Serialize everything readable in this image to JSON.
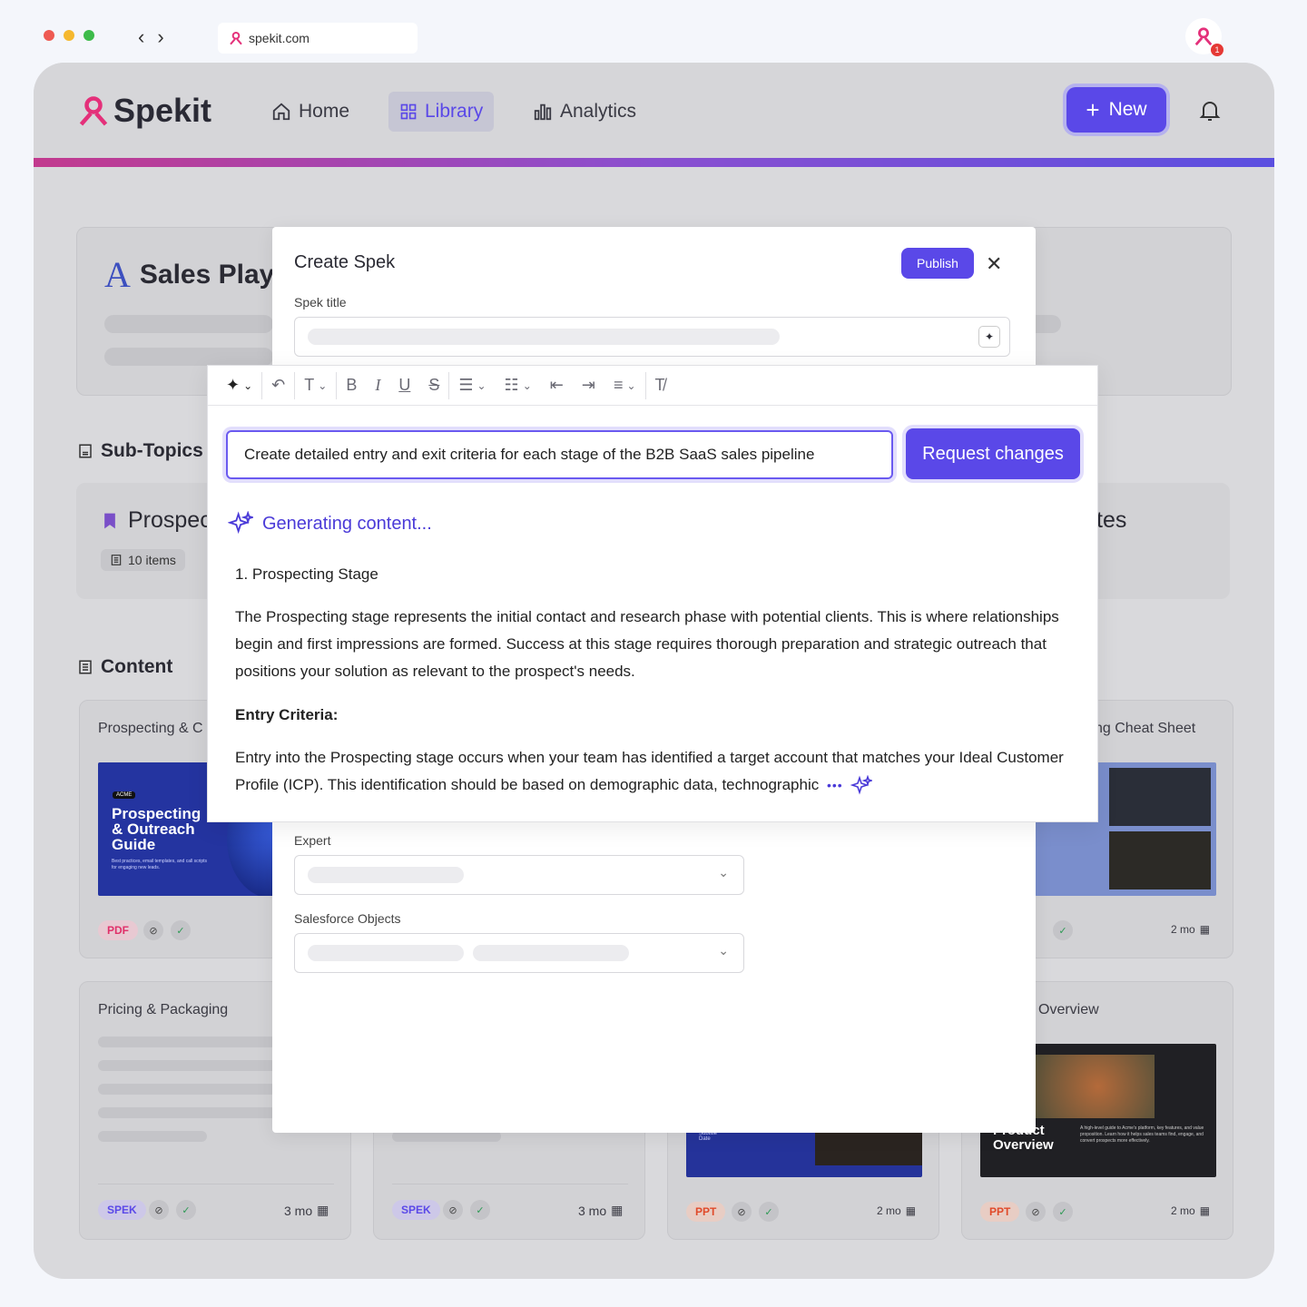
{
  "browser": {
    "url": "spekit.com",
    "ext_badge": "1",
    "dot_colors": [
      "#ee5a52",
      "#f5b82e",
      "#3dbb4a"
    ]
  },
  "nav": {
    "logo": "Spekit",
    "home": "Home",
    "library": "Library",
    "analytics": "Analytics",
    "new_label": "New"
  },
  "page": {
    "topic_title": "Sales Playl",
    "subtopics_heading": "Sub-Topics",
    "subtopic_name": "Prospec",
    "subtopic_count": "10 items",
    "subtopic_right": "tes",
    "content_heading": "Content",
    "cards": [
      {
        "title": "Prospecting & C",
        "type": "PDF",
        "thumb_title": "Prospecting & Outreach Guide",
        "thumb_sub": "Best practices, email templates, and call scripts for engaging new leads.",
        "brand": "ACME"
      },
      {
        "title": "ng Cheat Sheet",
        "age": "2 mo"
      },
      {
        "title": "Pricing & Packaging",
        "type": "SPEK",
        "age": "3 mo"
      },
      {
        "title": "",
        "type": "SPEK",
        "age": "3 mo"
      },
      {
        "title": "",
        "type": "PPT",
        "age": "2 mo",
        "thumb_sub": "Subtitle\nDate"
      },
      {
        "title": "Overview",
        "type": "PPT",
        "age": "2 mo",
        "thumb_title": "Product Overview",
        "thumb_sub": "A high-level guide to Acme's platform, key features, and value proposition. Learn how it helps sales teams find, engage, and convert prospects more effectively."
      }
    ]
  },
  "modal": {
    "title": "Create Spek",
    "publish": "Publish",
    "close": "✕",
    "spek_title_label": "Spek title",
    "expert_label": "Expert",
    "sf_label": "Salesforce Objects"
  },
  "editor": {
    "prompt": "Create detailed entry and exit criteria for each stage of the B2B SaaS sales pipeline",
    "request_changes": "Request changes",
    "generating": "Generating content...",
    "h1": "1. Prospecting Stage",
    "p1": "The Prospecting stage represents the initial contact and research phase with potential clients. This is where relationships begin and first impressions are formed. Success at this stage requires thorough preparation and strategic outreach that positions your solution as relevant to the prospect's needs.",
    "h2": "Entry Criteria:",
    "p2": "Entry into the Prospecting stage occurs when your team has identified a target account that matches your Ideal Customer Profile (ICP). This identification should be based on demographic data, technographic",
    "ellipsis": "•••"
  }
}
